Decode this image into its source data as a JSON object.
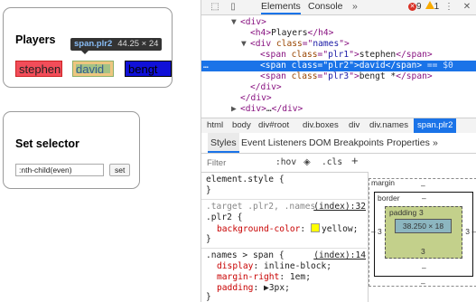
{
  "page": {
    "players_heading": "Players",
    "players": [
      "stephen",
      "david",
      "bengt"
    ],
    "hover_tip": {
      "name": "span.plr2",
      "size": "44.25 × 24"
    },
    "selector_heading": "Set selector",
    "selector_value": ":nth-child(even)",
    "set_label": "set"
  },
  "devtools": {
    "tabs": [
      "Elements",
      "Console",
      "»"
    ],
    "errors": "9",
    "warnings": "1",
    "dom": [
      {
        "indent": 3,
        "arrow": "▼",
        "parts": [
          [
            "tag",
            "<div>"
          ]
        ]
      },
      {
        "indent": 4,
        "arrow": "",
        "parts": [
          [
            "tag",
            "<h4>"
          ],
          [
            "txt",
            "Players"
          ],
          [
            "tag",
            "</h4>"
          ]
        ]
      },
      {
        "indent": 4,
        "arrow": "▼",
        "parts": [
          [
            "tag",
            "<div "
          ],
          [
            "attr",
            "class"
          ],
          [
            "tag",
            "=\""
          ],
          [
            "val",
            "names"
          ],
          [
            "tag",
            "\">"
          ]
        ]
      },
      {
        "indent": 5,
        "arrow": "",
        "parts": [
          [
            "tag",
            "<span "
          ],
          [
            "attr",
            "class"
          ],
          [
            "tag",
            "=\""
          ],
          [
            "val",
            "plr1"
          ],
          [
            "tag",
            "\">"
          ],
          [
            "txt",
            "stephen"
          ],
          [
            "tag",
            "</span>"
          ]
        ]
      },
      {
        "indent": 5,
        "arrow": "",
        "selected": true,
        "parts": [
          [
            "tag",
            "<span "
          ],
          [
            "attr",
            "class"
          ],
          [
            "tag",
            "=\""
          ],
          [
            "val",
            "plr2"
          ],
          [
            "tag",
            "\">"
          ],
          [
            "txt",
            "david"
          ],
          [
            "tag",
            "</span>"
          ],
          [
            "dim",
            " == $0"
          ]
        ]
      },
      {
        "indent": 5,
        "arrow": "",
        "parts": [
          [
            "tag",
            "<span "
          ],
          [
            "attr",
            "class"
          ],
          [
            "tag",
            "=\""
          ],
          [
            "val",
            "plr3"
          ],
          [
            "tag",
            "\">"
          ],
          [
            "txt",
            "bengt *"
          ],
          [
            "tag",
            "</span>"
          ]
        ]
      },
      {
        "indent": 4,
        "arrow": "",
        "parts": [
          [
            "tag",
            "</div>"
          ]
        ]
      },
      {
        "indent": 3,
        "arrow": "",
        "parts": [
          [
            "tag",
            "</div>"
          ]
        ]
      },
      {
        "indent": 3,
        "arrow": "▶",
        "parts": [
          [
            "tag",
            "<div>"
          ],
          [
            "txt",
            "…"
          ],
          [
            "tag",
            "</div>"
          ]
        ]
      }
    ],
    "breadcrumb": [
      "html",
      "body",
      "div#root",
      "div.boxes",
      "div",
      "div.names",
      "span.plr2"
    ],
    "subtabs": [
      "Styles",
      "Event Listeners",
      "DOM Breakpoints",
      "Properties",
      "»"
    ],
    "filter_placeholder": "Filter",
    "hov": ":hov",
    "cls": ".cls",
    "add": "+",
    "rules": {
      "element_style": "element.style {",
      "close1": "}",
      "sel2a": ".target .plr2, .names",
      "src2": "(index):32",
      "sel2b": ".plr2 {",
      "prop2": "background-color",
      "val2": "yellow;",
      "close2": "}",
      "sel3": ".names > span {",
      "src3": "(index):14",
      "prop3a": "display",
      "val3a": "inline-block;",
      "prop3b": "margin-right",
      "val3b": "1em;",
      "prop3c": "padding",
      "val3c": "▶3px;",
      "close3": "}"
    },
    "box_model": {
      "margin_label": "margin",
      "margin_top": "–",
      "border_label": "border",
      "border_top": "–",
      "padding_label": "padding",
      "padding": "3",
      "content": "38.250 × 18",
      "border_side": "–",
      "border_bottom": "–",
      "margin_bottom": "–"
    }
  }
}
